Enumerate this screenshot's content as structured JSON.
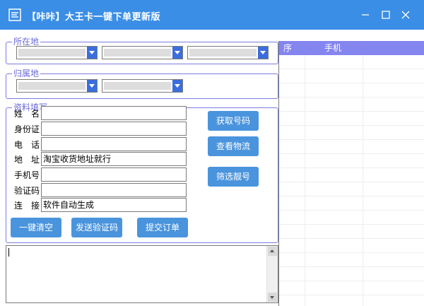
{
  "window": {
    "title": "【咔咔】大王卡一键下单更新版"
  },
  "location_group": {
    "label": "所在地",
    "combos": [
      "",
      "",
      ""
    ]
  },
  "belong_group": {
    "label": "归属地",
    "combos": [
      "",
      ""
    ]
  },
  "info_group": {
    "label": "资料填写",
    "fields": [
      {
        "label": "姓　名",
        "value": ""
      },
      {
        "label": "身份证",
        "value": ""
      },
      {
        "label": "电　话",
        "value": ""
      },
      {
        "label": "地　址",
        "value": "淘宝收货地址就行"
      },
      {
        "label": "手机号",
        "value": ""
      },
      {
        "label": "验证码",
        "value": ""
      },
      {
        "label": "连　接",
        "value": "软件自动生成"
      }
    ]
  },
  "buttons": {
    "get_number": "获取号码",
    "check_logistics": "查看物流",
    "filter_number": "筛选靓号",
    "clear_all": "一键清空",
    "send_code": "发送验证码",
    "submit_order": "提交订单"
  },
  "log": {
    "text": ""
  },
  "grid": {
    "columns": [
      "序",
      "手机"
    ],
    "rows": []
  },
  "colors": {
    "titlebar": "#3a8ee6",
    "button": "#4a94dd",
    "grid_header": "#8585f0",
    "group_border": "#7b7be0"
  },
  "icons": [
    "app-logo-icon",
    "minimize-icon",
    "maximize-icon",
    "close-icon"
  ]
}
